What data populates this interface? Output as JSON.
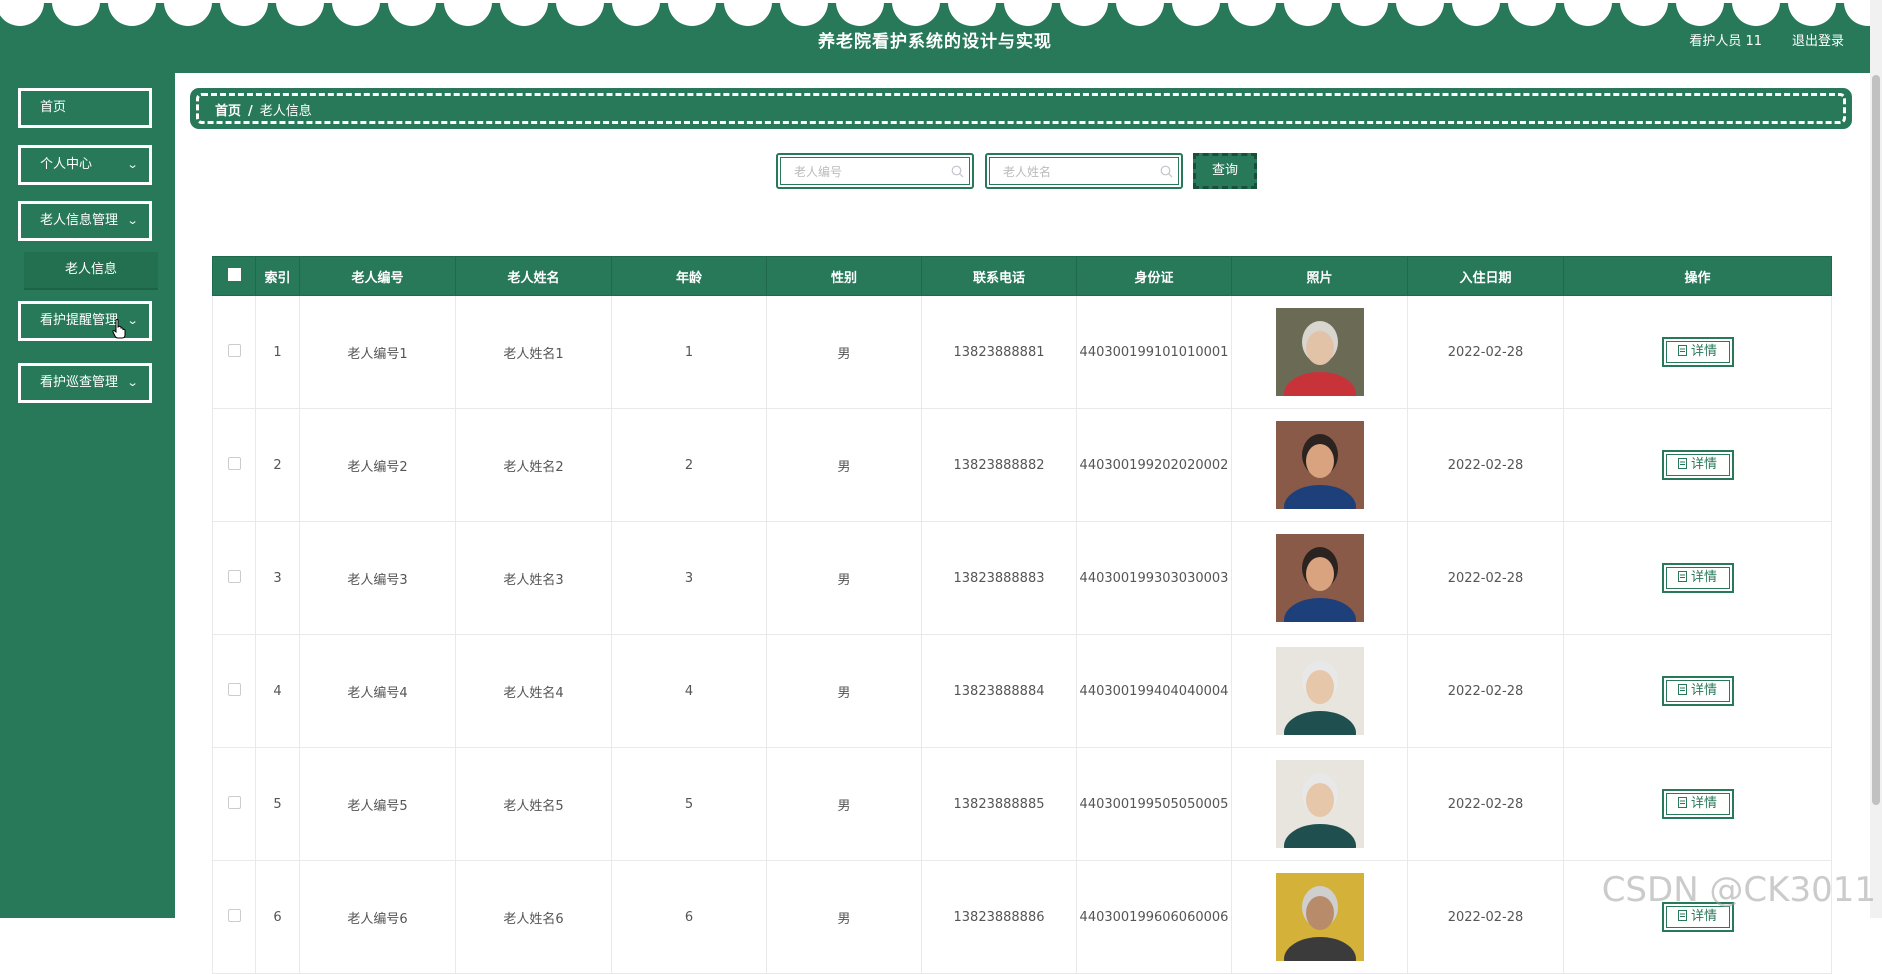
{
  "header": {
    "title": "养老院看护系统的设计与实现",
    "user_name": "看护人员 11",
    "logout": "退出登录"
  },
  "sidebar": {
    "items": [
      {
        "label": "首页"
      },
      {
        "label": "个人中心"
      },
      {
        "label": "老人信息管理"
      },
      {
        "label": "看护提醒管理"
      },
      {
        "label": "看护巡查管理"
      }
    ],
    "submenu": {
      "label": "老人信息"
    }
  },
  "breadcrumb": {
    "home": "首页",
    "separator": "/",
    "current": "老人信息"
  },
  "search": {
    "elder_no_placeholder": "老人编号",
    "elder_name_placeholder": "老人姓名",
    "query_label": "查询"
  },
  "table": {
    "headers": [
      "索引",
      "老人编号",
      "老人姓名",
      "年龄",
      "性别",
      "联系电话",
      "身份证",
      "照片",
      "入住日期",
      "操作"
    ],
    "detail_label": "详情",
    "rows": [
      {
        "index": "1",
        "elder_no": "老人编号1",
        "elder_name": "老人姓名1",
        "age": "1",
        "gender": "男",
        "phone": "13823888881",
        "id_card": "440300199101010001",
        "date": "2022-02-28",
        "photo": "elderly-woman-red-top"
      },
      {
        "index": "2",
        "elder_no": "老人编号2",
        "elder_name": "老人姓名2",
        "age": "2",
        "gender": "男",
        "phone": "13823888882",
        "id_card": "440300199202020002",
        "date": "2022-02-28",
        "photo": "man-blue-sweater"
      },
      {
        "index": "3",
        "elder_no": "老人编号3",
        "elder_name": "老人姓名3",
        "age": "3",
        "gender": "男",
        "phone": "13823888883",
        "id_card": "440300199303030003",
        "date": "2022-02-28",
        "photo": "man-blue-sweater"
      },
      {
        "index": "4",
        "elder_no": "老人编号4",
        "elder_name": "老人姓名4",
        "age": "4",
        "gender": "男",
        "phone": "13823888884",
        "id_card": "440300199404040004",
        "date": "2022-02-28",
        "photo": "elderly-woman-scarf"
      },
      {
        "index": "5",
        "elder_no": "老人编号5",
        "elder_name": "老人姓名5",
        "age": "5",
        "gender": "男",
        "phone": "13823888885",
        "id_card": "440300199505050005",
        "date": "2022-02-28",
        "photo": "elderly-woman-scarf"
      },
      {
        "index": "6",
        "elder_no": "老人编号6",
        "elder_name": "老人姓名6",
        "age": "6",
        "gender": "男",
        "phone": "13823888886",
        "id_card": "440300199606060006",
        "date": "2022-02-28",
        "photo": "elderly-man-yellow-bg"
      }
    ]
  },
  "watermark": "CSDN @CK3011",
  "colors": {
    "primary": "#27795a",
    "white": "#ffffff"
  }
}
